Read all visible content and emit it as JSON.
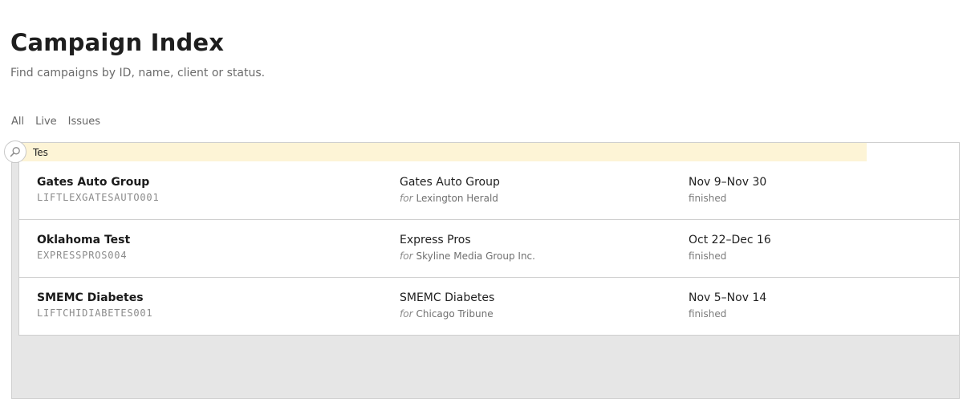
{
  "header": {
    "title": "Campaign Index",
    "subtitle": "Find campaigns by ID, name, client or status."
  },
  "filters": [
    "All",
    "Live",
    "Issues"
  ],
  "search": {
    "value": "Tes",
    "icon": "search-icon"
  },
  "for_label": "for",
  "campaigns": [
    {
      "name": "Gates Auto Group",
      "code": "LIFTLEXGATESAUTO001",
      "client": "Gates Auto Group",
      "publisher": "Lexington Herald",
      "dates": "Nov 9–Nov 30",
      "status": "finished"
    },
    {
      "name": "Oklahoma Test",
      "code": "EXPRESSPROS004",
      "client": "Express Pros",
      "publisher": "Skyline Media Group Inc.",
      "dates": "Oct 22–Dec 16",
      "status": "finished"
    },
    {
      "name": "SMEMC Diabetes",
      "code": "LIFTCHIDIABETES001",
      "client": "SMEMC Diabetes",
      "publisher": "Chicago Tribune",
      "dates": "Nov 5–Nov 14",
      "status": "finished"
    }
  ],
  "colors": {
    "search_highlight": "#fdf4d6",
    "panel_background": "#e6e6e6",
    "border": "#cfcfcf"
  }
}
